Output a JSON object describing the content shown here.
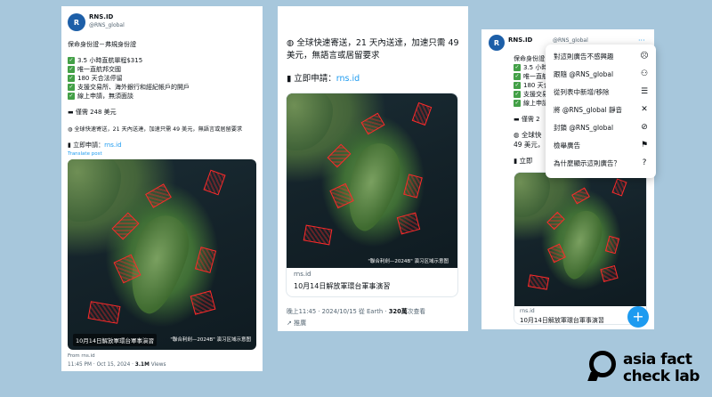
{
  "panel1": {
    "name": "RNS.ID",
    "handle": "@RNS_global",
    "headline": "保命身份證－弗規身份證",
    "checks": [
      "3.5 小時直航單程$315",
      "唯一直航邦交國",
      "180 天合法停留",
      "支援交易所、海外銀行和經紀帳戶的開戶",
      "線上申請，無須面談"
    ],
    "price": "僅需 248 美元",
    "shipping": "全球快速寄送，21 天內送達，加速只需 49 美元，無語言或居留要求",
    "apply_label": "立即申請：",
    "apply_link": "rns.id",
    "translate": "Translate post",
    "map_title": "10月14日解放軍環台軍事演習",
    "map_caption": "\"聯合利劍—2024B\" 演习区域示意图",
    "from": "From rns.id",
    "time": "11:45 PM · Oct 15, 2024 ·",
    "views_count": "3.1M",
    "views_label": "Views"
  },
  "panel2": {
    "shipping_line1": "全球快速寄送，21 天內送達，加速只需 49",
    "shipping_line2": "美元，無語言或居留要求",
    "apply_label": "立即申請：",
    "apply_link": "rns.id",
    "map_caption": "\"聯合利劍—2024B\" 演习区域示意图",
    "card_domain": "rns.id",
    "card_title": "10月14日解放軍環台軍事演習",
    "meta_time": "晚上11:45 · 2024/10/15 從 Earth ·",
    "meta_views": "320萬",
    "meta_views_label": "次查看",
    "promoted": "推廣"
  },
  "panel3": {
    "name": "RNS.ID",
    "handle": "@RNS_global",
    "headline": "保命身份證－弗規身份證",
    "checks": [
      "3.5 小時",
      "唯一直航",
      "180 天合",
      "支援交易",
      "線上申請"
    ],
    "price": "僅需 2",
    "ship_line1": "全球快",
    "ship_line2": "49 美元，",
    "apply": "立即",
    "card_domain": "rns.id",
    "card_title": "10月14日解放軍環台軍事演習"
  },
  "menu": {
    "items": [
      {
        "label": "對這則廣告不感興趣",
        "icon": "frown-icon"
      },
      {
        "label": "跟隨 @RNS_global",
        "icon": "follow-icon"
      },
      {
        "label": "從列表中新增/移除",
        "icon": "list-icon"
      },
      {
        "label": "將 @RNS_global 靜音",
        "icon": "mute-icon"
      },
      {
        "label": "封鎖 @RNS_global",
        "icon": "block-icon"
      },
      {
        "label": "檢舉廣告",
        "icon": "flag-icon"
      },
      {
        "label": "為什麼顯示這則廣告？",
        "icon": "question-icon"
      }
    ]
  },
  "fab_label": "+",
  "logo": {
    "line1": "asia fact",
    "line2": "check lab"
  },
  "colors": {
    "background": "#a7c7dc",
    "link": "#1d9bf0",
    "drill": "#ff2a2a",
    "check": "#43a047"
  }
}
